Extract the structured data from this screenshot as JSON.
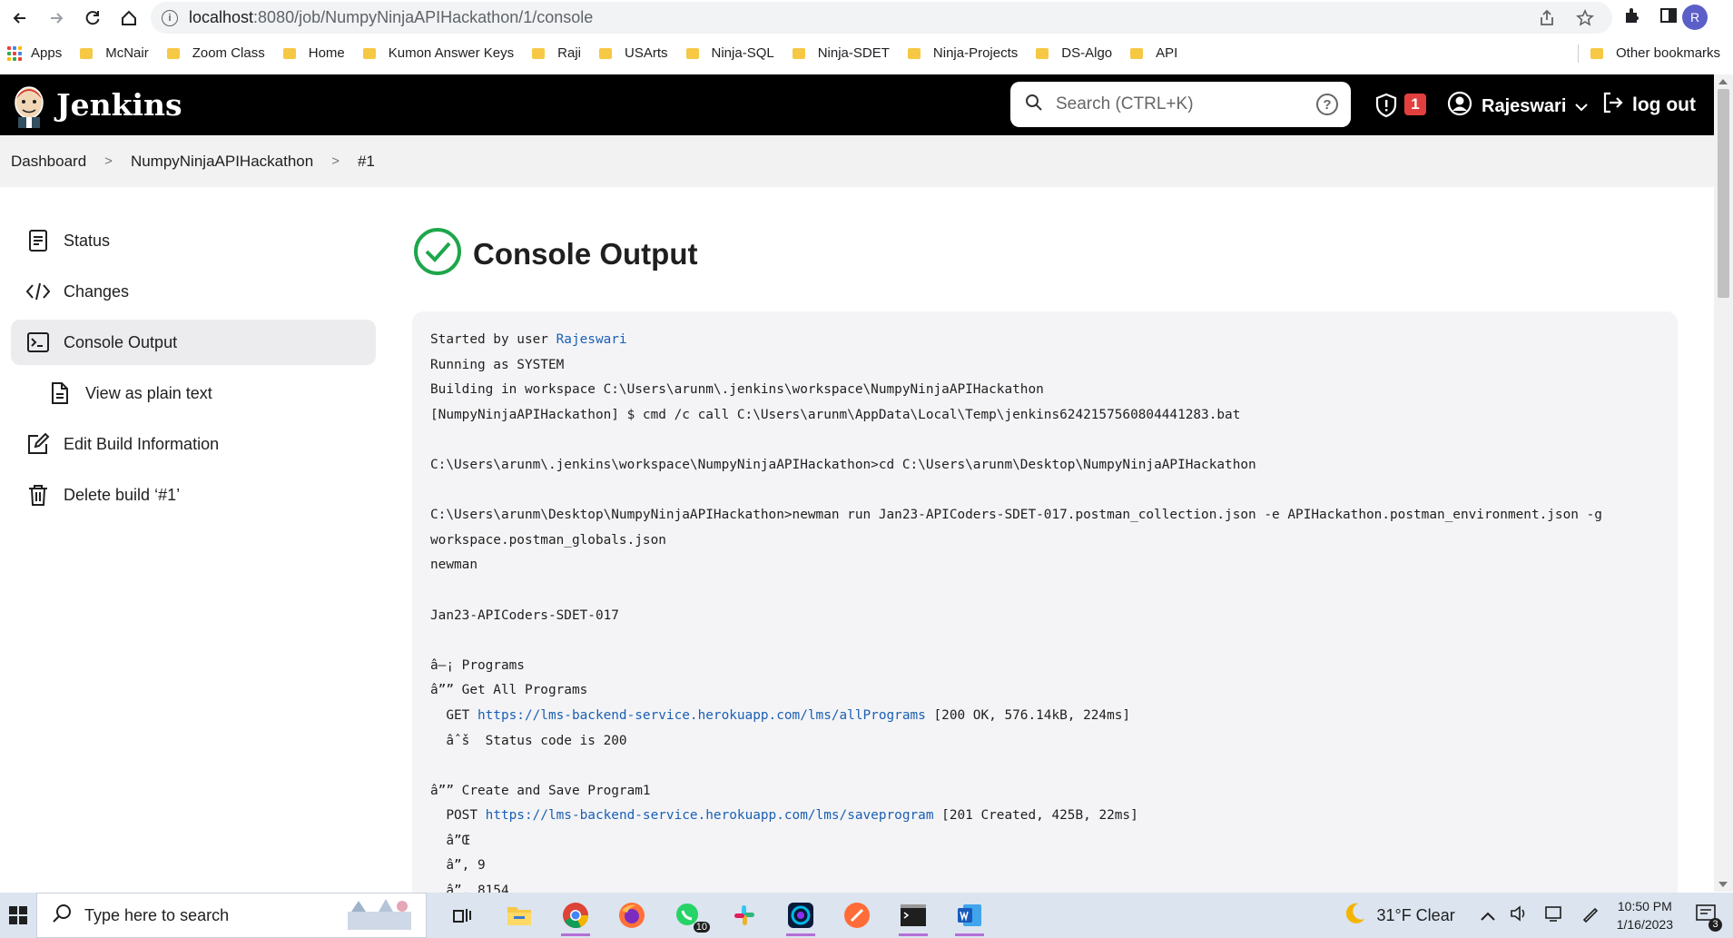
{
  "browser": {
    "url_host": "localhost",
    "url_path": ":8080/job/NumpyNinjaAPIHackathon/1/console",
    "profile_initial": "R",
    "bookmarks": [
      "Apps",
      "McNair",
      "Zoom Class",
      "Home",
      "Kumon Answer Keys",
      "Raji",
      "USArts",
      "Ninja-SQL",
      "Ninja-SDET",
      "Ninja-Projects",
      "DS-Algo",
      "API"
    ],
    "other_bookmarks": "Other bookmarks"
  },
  "header": {
    "title": "Jenkins",
    "search_placeholder": "Search (CTRL+K)",
    "help": "?",
    "alert_count": "1",
    "user": "Rajeswari",
    "logout": "log out"
  },
  "breadcrumb": {
    "items": [
      "Dashboard",
      "NumpyNinjaAPIHackathon",
      "#1"
    ]
  },
  "sidebar": {
    "items": [
      {
        "label": "Status",
        "icon": "document-icon"
      },
      {
        "label": "Changes",
        "icon": "code-icon"
      },
      {
        "label": "Console Output",
        "icon": "terminal-icon"
      },
      {
        "label": "View as plain text",
        "icon": "file-icon"
      },
      {
        "label": "Edit Build Information",
        "icon": "edit-icon"
      },
      {
        "label": "Delete build ‘#1’",
        "icon": "trash-icon"
      }
    ]
  },
  "main": {
    "title": "Console Output",
    "status_color": "#1ea64b"
  },
  "console": {
    "started_prefix": "Started by user ",
    "started_user": "Rajeswari",
    "line_running": "Running as SYSTEM",
    "line_building": "Building in workspace C:\\Users\\arunm\\.jenkins\\workspace\\NumpyNinjaAPIHackathon",
    "line_cmd": "[NumpyNinjaAPIHackathon] $ cmd /c call C:\\Users\\arunm\\AppData\\Local\\Temp\\jenkins6242157560804441283.bat",
    "line_cd": "C:\\Users\\arunm\\.jenkins\\workspace\\NumpyNinjaAPIHackathon>cd C:\\Users\\arunm\\Desktop\\NumpyNinjaAPIHackathon",
    "line_newman1": "C:\\Users\\arunm\\Desktop\\NumpyNinjaAPIHackathon>newman run Jan23-APICoders-SDET-017.postman_collection.json -e APIHackathon.postman_environment.json -g",
    "line_newman2": "workspace.postman_globals.json",
    "line_newman3": "newman",
    "line_collection": "Jan23-APICoders-SDET-017",
    "line_programs": "â–¡ Programs",
    "line_getall": "â”” Get All Programs",
    "get_method": "  GET ",
    "get_url": "https://lms-backend-service.herokuapp.com/lms/allPrograms",
    "get_result": " [200 OK, 576.14kB, 224ms]",
    "line_status": "  âˆš  Status code is 200",
    "line_create": "â”” Create and Save Program1",
    "post_method": "  POST ",
    "post_url": "https://lms-backend-service.herokuapp.com/lms/saveprogram",
    "post_result": " [201 Created, 425B, 22ms]",
    "line_a": "  â”Œ",
    "line_b": "  â”‚ 9",
    "line_c": "  â”‚ 8154"
  },
  "taskbar": {
    "search_text": "Type here to search",
    "whatsapp_badge": "10",
    "weather": "31°F  Clear",
    "time": "10:50 PM",
    "date": "1/16/2023",
    "notif_count": "3"
  }
}
